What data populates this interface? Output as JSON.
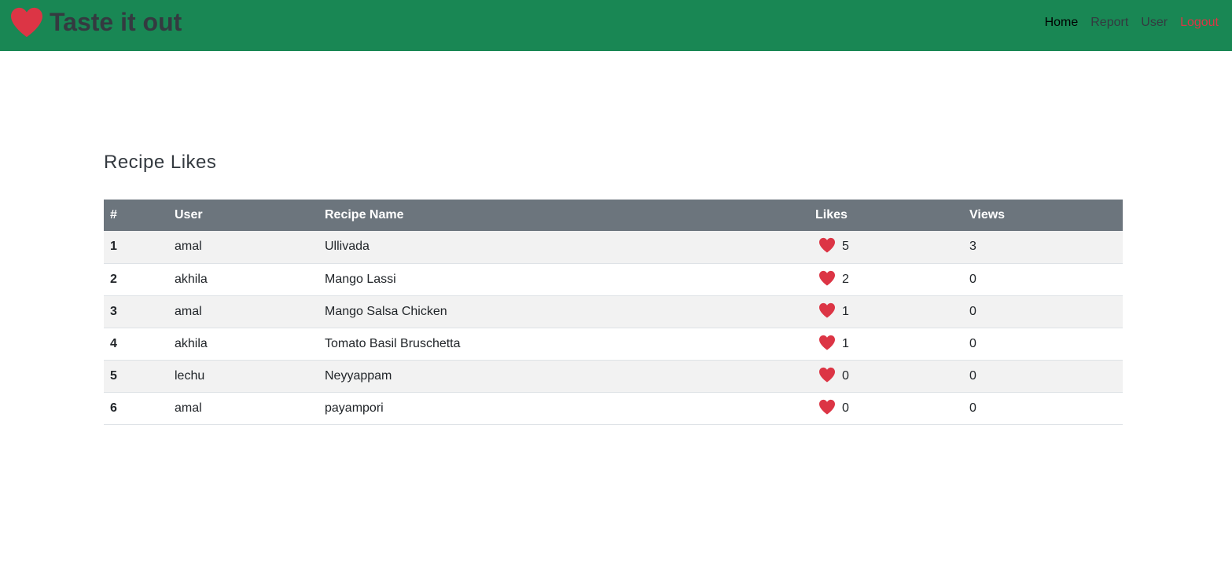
{
  "brand": {
    "title": "Taste it out",
    "icon": "heart-icon"
  },
  "nav": {
    "home": "Home",
    "report": "Report",
    "user": "User",
    "logout": "Logout"
  },
  "colors": {
    "navbar": "#198754",
    "heart": "#dc3545",
    "table_header": "#6c757d",
    "logout": "#dc3545"
  },
  "page": {
    "heading": "Recipe Likes"
  },
  "table": {
    "headers": [
      "#",
      "User",
      "Recipe Name",
      "Likes",
      "Views"
    ],
    "rows": [
      {
        "rank": "1",
        "user": "amal",
        "recipe": "Ullivada",
        "likes": "5",
        "views": "3"
      },
      {
        "rank": "2",
        "user": "akhila",
        "recipe": "Mango Lassi",
        "likes": "2",
        "views": "0"
      },
      {
        "rank": "3",
        "user": "amal",
        "recipe": "Mango Salsa Chicken",
        "likes": "1",
        "views": "0"
      },
      {
        "rank": "4",
        "user": "akhila",
        "recipe": "Tomato Basil Bruschetta",
        "likes": "1",
        "views": "0"
      },
      {
        "rank": "5",
        "user": "lechu",
        "recipe": "Neyyappam",
        "likes": "0",
        "views": "0"
      },
      {
        "rank": "6",
        "user": "amal",
        "recipe": "payampori",
        "likes": "0",
        "views": "0"
      }
    ]
  }
}
